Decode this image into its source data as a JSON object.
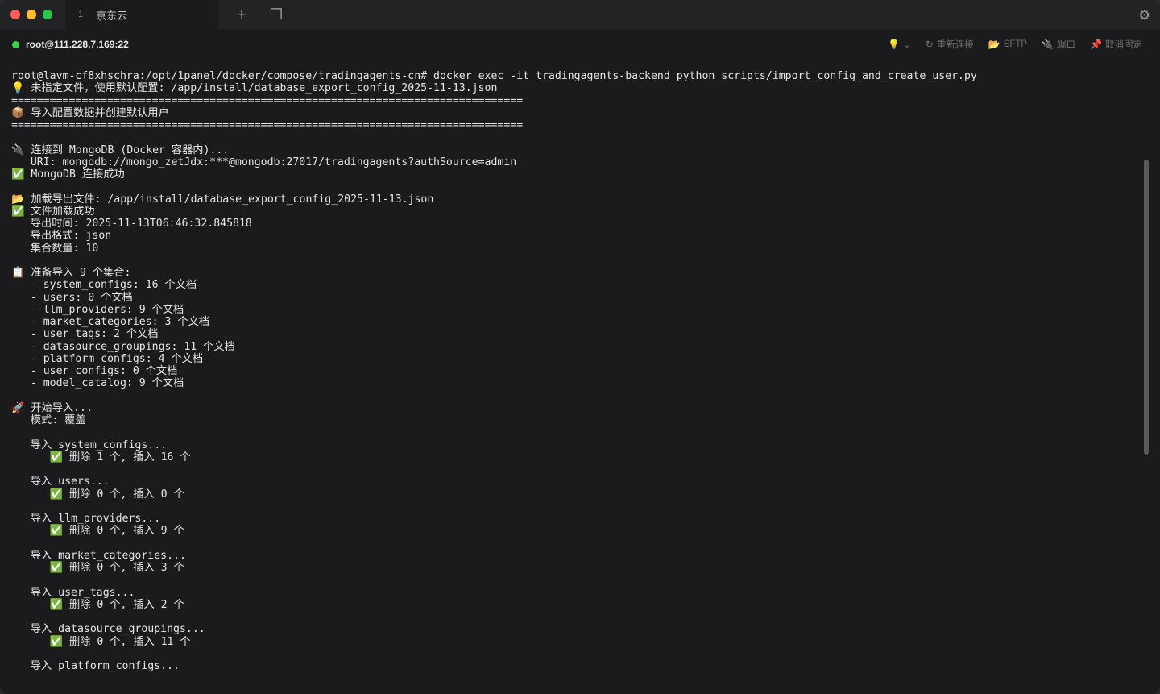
{
  "titlebar": {
    "tab_number": "1",
    "tab_title": "京东云",
    "new_tab_icon": "plus-icon",
    "new_window_icon": "window-icon",
    "settings_icon": "gear-icon"
  },
  "hostbar": {
    "host": "root@111.228.7.169:22",
    "status_color": "#3bd34a",
    "actions": [
      {
        "icon": "lightbulb-icon",
        "label": "⌄"
      },
      {
        "icon": "refresh-icon",
        "label": "重新连接"
      },
      {
        "icon": "folder-icon",
        "label": "SFTP"
      },
      {
        "icon": "plug-icon",
        "label": "端口"
      },
      {
        "icon": "pin-icon",
        "label": "取消固定"
      }
    ]
  },
  "terminal": {
    "lines": [
      {
        "prefix": "",
        "text": "root@lavm-cf8xhschra:/opt/1panel/docker/compose/tradingagents-cn# docker exec -it tradingagents-backend python scripts/import_config_and_create_user.py"
      },
      {
        "prefix": "💡",
        "text": " 未指定文件，使用默认配置: /app/install/database_export_config_2025-11-13.json"
      },
      {
        "prefix": "",
        "text": "================================================================================"
      },
      {
        "prefix": "📦",
        "text": " 导入配置数据并创建默认用户"
      },
      {
        "prefix": "",
        "text": "================================================================================"
      },
      {
        "prefix": "",
        "text": ""
      },
      {
        "prefix": "🔌",
        "text": " 连接到 MongoDB (Docker 容器内)..."
      },
      {
        "prefix": "",
        "text": "   URI: mongodb://mongo_zetJdx:***@mongodb:27017/tradingagents?authSource=admin"
      },
      {
        "prefix": "✅",
        "text": " MongoDB 连接成功"
      },
      {
        "prefix": "",
        "text": ""
      },
      {
        "prefix": "📂",
        "text": " 加载导出文件: /app/install/database_export_config_2025-11-13.json"
      },
      {
        "prefix": "✅",
        "text": " 文件加载成功"
      },
      {
        "prefix": "",
        "text": "   导出时间: 2025-11-13T06:46:32.845818"
      },
      {
        "prefix": "",
        "text": "   导出格式: json"
      },
      {
        "prefix": "",
        "text": "   集合数量: 10"
      },
      {
        "prefix": "",
        "text": ""
      },
      {
        "prefix": "📋",
        "text": " 准备导入 9 个集合:"
      },
      {
        "prefix": "",
        "text": "   - system_configs: 16 个文档"
      },
      {
        "prefix": "",
        "text": "   - users: 0 个文档"
      },
      {
        "prefix": "",
        "text": "   - llm_providers: 9 个文档"
      },
      {
        "prefix": "",
        "text": "   - market_categories: 3 个文档"
      },
      {
        "prefix": "",
        "text": "   - user_tags: 2 个文档"
      },
      {
        "prefix": "",
        "text": "   - datasource_groupings: 11 个文档"
      },
      {
        "prefix": "",
        "text": "   - platform_configs: 4 个文档"
      },
      {
        "prefix": "",
        "text": "   - user_configs: 0 个文档"
      },
      {
        "prefix": "",
        "text": "   - model_catalog: 9 个文档"
      },
      {
        "prefix": "",
        "text": ""
      },
      {
        "prefix": "🚀",
        "text": " 开始导入..."
      },
      {
        "prefix": "",
        "text": "   模式: 覆盖"
      },
      {
        "prefix": "",
        "text": ""
      },
      {
        "prefix": "",
        "text": "   导入 system_configs..."
      },
      {
        "prefix": "      ✅",
        "text": " 删除 1 个, 插入 16 个"
      },
      {
        "prefix": "",
        "text": ""
      },
      {
        "prefix": "",
        "text": "   导入 users..."
      },
      {
        "prefix": "      ✅",
        "text": " 删除 0 个, 插入 0 个"
      },
      {
        "prefix": "",
        "text": ""
      },
      {
        "prefix": "",
        "text": "   导入 llm_providers..."
      },
      {
        "prefix": "      ✅",
        "text": " 删除 0 个, 插入 9 个"
      },
      {
        "prefix": "",
        "text": ""
      },
      {
        "prefix": "",
        "text": "   导入 market_categories..."
      },
      {
        "prefix": "      ✅",
        "text": " 删除 0 个, 插入 3 个"
      },
      {
        "prefix": "",
        "text": ""
      },
      {
        "prefix": "",
        "text": "   导入 user_tags..."
      },
      {
        "prefix": "      ✅",
        "text": " 删除 0 个, 插入 2 个"
      },
      {
        "prefix": "",
        "text": ""
      },
      {
        "prefix": "",
        "text": "   导入 datasource_groupings..."
      },
      {
        "prefix": "      ✅",
        "text": " 删除 0 个, 插入 11 个"
      },
      {
        "prefix": "",
        "text": ""
      },
      {
        "prefix": "",
        "text": "   导入 platform_configs..."
      }
    ]
  }
}
